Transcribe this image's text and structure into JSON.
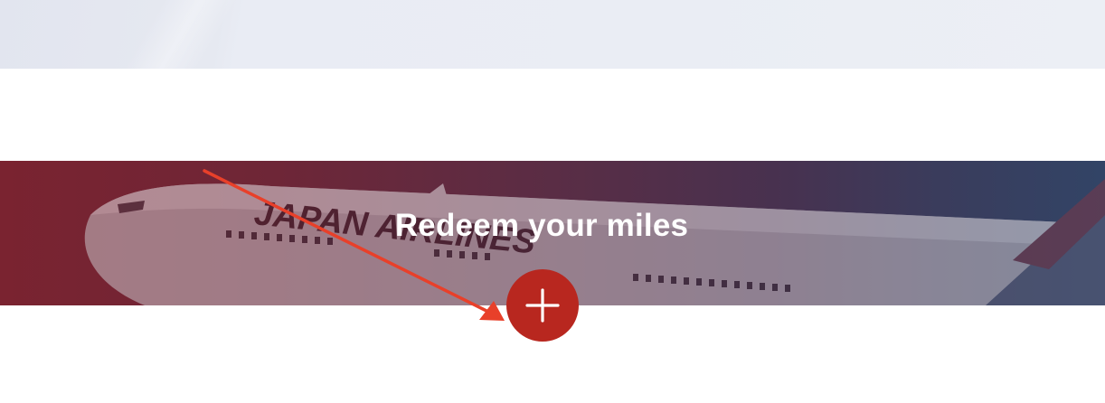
{
  "hero": {
    "title": "Redeem your miles",
    "plane_livery_text": "JAPAN AIRLINES"
  },
  "expand_button": {
    "icon": "plus-icon",
    "color": "#b8271f"
  },
  "annotation": {
    "type": "arrow",
    "color": "#e8402a"
  },
  "colors": {
    "banner_left": "#7a2330",
    "banner_right": "#324466",
    "top_band": "#e9ecf4"
  }
}
